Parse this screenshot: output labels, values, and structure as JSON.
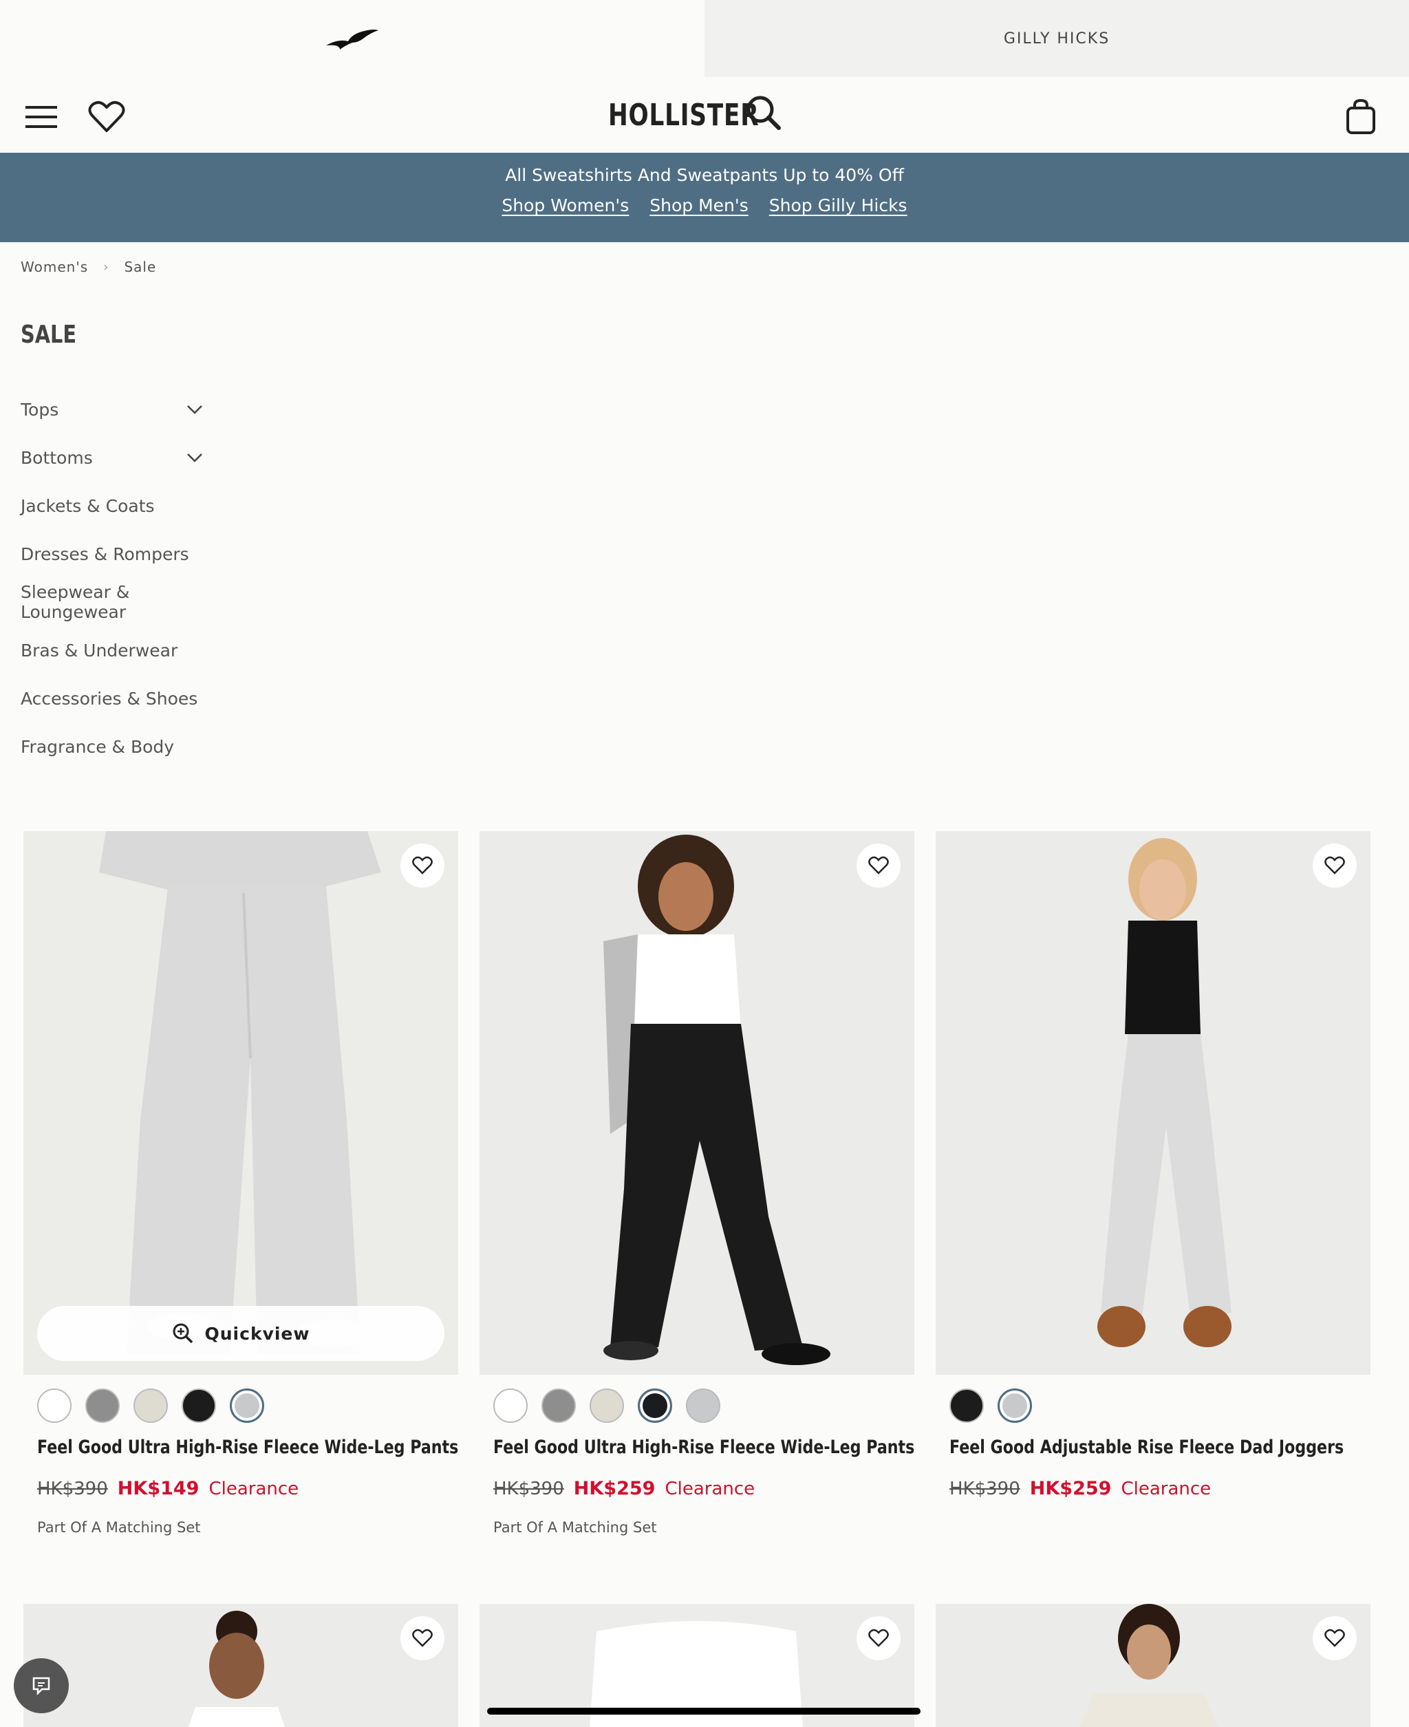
{
  "brand_tabs": {
    "gilly_label": "GILLY HICKS"
  },
  "header": {
    "logo": "HOLLISTER"
  },
  "promo": {
    "title": "All Sweatshirts And Sweatpants Up to 40% Off",
    "links": [
      "Shop Women's",
      "Shop Men's",
      "Shop Gilly Hicks"
    ]
  },
  "breadcrumb": [
    "Women's",
    "Sale"
  ],
  "page_title": "SALE",
  "categories": [
    {
      "label": "Tops",
      "expandable": true
    },
    {
      "label": "Bottoms",
      "expandable": true
    },
    {
      "label": "Jackets & Coats"
    },
    {
      "label": "Dresses & Rompers"
    },
    {
      "label": "Sleepwear & Loungewear"
    },
    {
      "label": "Bras & Underwear"
    },
    {
      "label": "Accessories & Shoes"
    },
    {
      "label": "Fragrance & Body"
    }
  ],
  "quickview_label": "Quickview",
  "products": [
    {
      "name": "Feel Good Ultra High-Rise Fleece Wide-Leg Pants",
      "old_price": "HK$390",
      "new_price": "HK$149",
      "tag": "Clearance",
      "badge": "Part Of A Matching Set",
      "swatches": [
        "#ffffff",
        "#8e8e8e",
        "#dedbd0",
        "#1c1c1c",
        "#c7c9cb"
      ],
      "selected_swatch": 4
    },
    {
      "name": "Feel Good Ultra High-Rise Fleece Wide-Leg Pants",
      "old_price": "HK$390",
      "new_price": "HK$259",
      "tag": "Clearance",
      "badge": "Part Of A Matching Set",
      "swatches": [
        "#ffffff",
        "#8e8e8e",
        "#dedbd0",
        "#1a1c22",
        "#c7c9cb"
      ],
      "selected_swatch": 3
    },
    {
      "name": "Feel Good Adjustable Rise Fleece Dad Joggers",
      "old_price": "HK$390",
      "new_price": "HK$259",
      "tag": "Clearance",
      "badge": "",
      "swatches": [
        "#1c1c1c",
        "#c7c9cb"
      ],
      "selected_swatch": 1
    }
  ],
  "colors": {
    "promo_bg": "#4f6e84",
    "sale_red": "#d0102e"
  }
}
